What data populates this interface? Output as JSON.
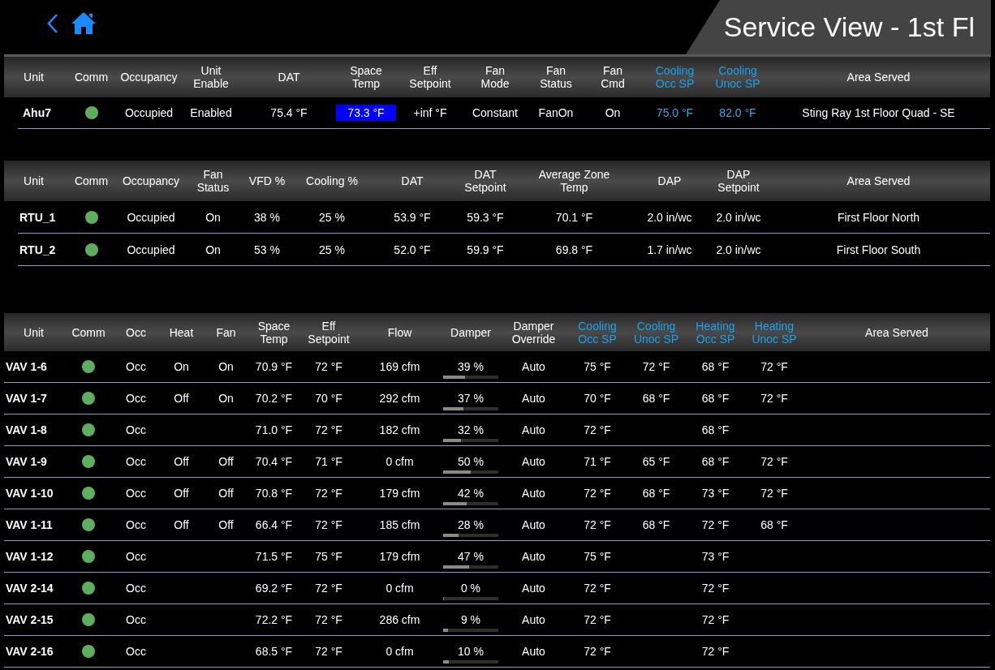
{
  "header": {
    "title": "Service View - 1st Fl"
  },
  "tables": [
    {
      "columns": [
        {
          "label": "Unit",
          "accent": false
        },
        {
          "label": "Comm",
          "accent": false
        },
        {
          "label": "Occupancy",
          "accent": false
        },
        {
          "label": "Unit\nEnable",
          "accent": false
        },
        {
          "label": "DAT",
          "accent": false
        },
        {
          "label": "Space\nTemp",
          "accent": false
        },
        {
          "label": "Eff\nSetpoint",
          "accent": false
        },
        {
          "label": "Fan\nMode",
          "accent": false
        },
        {
          "label": "Fan\nStatus",
          "accent": false
        },
        {
          "label": "Fan\nCmd",
          "accent": false
        },
        {
          "label": "Cooling\nOcc SP",
          "accent": true
        },
        {
          "label": "Cooling\nUnoc SP",
          "accent": true
        },
        {
          "label": "Area Served",
          "accent": false
        }
      ],
      "rows": [
        {
          "cells": [
            "Ahu7",
            {
              "comm": true
            },
            "Occupied",
            "Enabled",
            "75.4 °F",
            {
              "text": "73.3 °F",
              "highlighted": true
            },
            "+inf °F",
            "Constant",
            "FanOn",
            "On",
            {
              "text": "75.0 °F",
              "accent": true
            },
            {
              "text": "82.0 °F",
              "accent": true
            },
            "Sting Ray 1st Floor Quad - SE"
          ]
        }
      ]
    },
    {
      "columns": [
        {
          "label": "Unit",
          "accent": false
        },
        {
          "label": "Comm",
          "accent": false
        },
        {
          "label": "Occupancy",
          "accent": false
        },
        {
          "label": "Fan\nStatus",
          "accent": false
        },
        {
          "label": "VFD %",
          "accent": false
        },
        {
          "label": "Cooling %",
          "accent": false
        },
        {
          "label": "DAT",
          "accent": false
        },
        {
          "label": "DAT\nSetpoint",
          "accent": false
        },
        {
          "label": "Average Zone\nTemp",
          "accent": false
        },
        {
          "label": "DAP",
          "accent": false
        },
        {
          "label": "DAP\nSetpoint",
          "accent": false
        },
        {
          "label": "Area Served",
          "accent": false
        }
      ],
      "rows": [
        {
          "cells": [
            "RTU_1",
            {
              "comm": true
            },
            "Occupied",
            "On",
            "38 %",
            "25 %",
            "53.9 °F",
            "59.3 °F",
            "70.1 °F",
            "2.0 in/wc",
            "2.0 in/wc",
            "First Floor North"
          ]
        },
        {
          "cells": [
            "RTU_2",
            {
              "comm": true
            },
            "Occupied",
            "On",
            "53 %",
            "25 %",
            "52.0 °F",
            "59.9 °F",
            "69.8 °F",
            "1.7 in/wc",
            "2.0 in/wc",
            "First Floor South"
          ]
        }
      ]
    },
    {
      "columns": [
        {
          "label": "Unit",
          "accent": false
        },
        {
          "label": "Comm",
          "accent": false
        },
        {
          "label": "Occ",
          "accent": false
        },
        {
          "label": "Heat",
          "accent": false
        },
        {
          "label": "Fan",
          "accent": false
        },
        {
          "label": "Space\nTemp",
          "accent": false
        },
        {
          "label": "Eff\nSetpoint",
          "accent": false
        },
        {
          "label": "Flow",
          "accent": false
        },
        {
          "label": "Damper",
          "accent": false
        },
        {
          "label": "Damper\nOverride",
          "accent": false
        },
        {
          "label": "Cooling\nOcc SP",
          "accent": true
        },
        {
          "label": "Cooling\nUnoc SP",
          "accent": true
        },
        {
          "label": "Heating\nOcc SP",
          "accent": true
        },
        {
          "label": "Heating\nUnoc SP",
          "accent": true
        },
        {
          "label": "Area Served",
          "accent": false
        }
      ],
      "rows": [
        {
          "cells": [
            "VAV 1-6",
            {
              "comm": true
            },
            "Occ",
            "On",
            "On",
            "70.9 °F",
            "72 °F",
            "169 cfm",
            {
              "text": "39 %",
              "level": 0.39
            },
            "Auto",
            "75 °F",
            "72 °F",
            "68 °F",
            "72 °F",
            null
          ]
        },
        {
          "cells": [
            "VAV 1-7",
            {
              "comm": true
            },
            "Occ",
            "Off",
            "On",
            "70.2 °F",
            "70 °F",
            "292 cfm",
            {
              "text": "37 %",
              "level": 0.37
            },
            "Auto",
            "70 °F",
            "68 °F",
            "68 °F",
            "72 °F",
            null
          ]
        },
        {
          "cells": [
            "VAV 1-8",
            {
              "comm": true
            },
            "Occ",
            null,
            null,
            "71.0 °F",
            "72 °F",
            "182 cfm",
            {
              "text": "32 %",
              "level": 0.32
            },
            "Auto",
            "72 °F",
            null,
            "68 °F",
            null,
            null
          ]
        },
        {
          "cells": [
            "VAV 1-9",
            {
              "comm": true
            },
            "Occ",
            "Off",
            "Off",
            "70.4 °F",
            "71 °F",
            "0 cfm",
            {
              "text": "50 %",
              "level": 0.5
            },
            "Auto",
            "71 °F",
            "65 °F",
            "68 °F",
            "72 °F",
            null
          ]
        },
        {
          "cells": [
            "VAV 1-10",
            {
              "comm": true
            },
            "Occ",
            "Off",
            "Off",
            "70.8 °F",
            "72 °F",
            "179 cfm",
            {
              "text": "42 %",
              "level": 0.42
            },
            "Auto",
            "72 °F",
            "68 °F",
            "73 °F",
            "72 °F",
            null
          ]
        },
        {
          "cells": [
            "VAV 1-11",
            {
              "comm": true
            },
            "Occ",
            "Off",
            "Off",
            "66.4 °F",
            "72 °F",
            "185 cfm",
            {
              "text": "28 %",
              "level": 0.28
            },
            "Auto",
            "72 °F",
            "68 °F",
            "72 °F",
            "68 °F",
            null
          ]
        },
        {
          "cells": [
            "VAV 1-12",
            {
              "comm": true
            },
            "Occ",
            null,
            null,
            "71.5 °F",
            "75 °F",
            "179 cfm",
            {
              "text": "47 %",
              "level": 0.47
            },
            "Auto",
            "75 °F",
            null,
            "73 °F",
            null,
            null
          ]
        },
        {
          "cells": [
            "VAV 2-14",
            {
              "comm": true
            },
            "Occ",
            null,
            null,
            "69.2 °F",
            "72 °F",
            "0 cfm",
            {
              "text": "0 %",
              "level": 0
            },
            "Auto",
            "72 °F",
            null,
            "72 °F",
            null,
            null
          ]
        },
        {
          "cells": [
            "VAV 2-15",
            {
              "comm": true
            },
            "Occ",
            null,
            null,
            "72.2 °F",
            "72 °F",
            "286 cfm",
            {
              "text": "9 %",
              "level": 0.09
            },
            "Auto",
            "72 °F",
            null,
            "72 °F",
            null,
            null
          ]
        },
        {
          "cells": [
            "VAV 2-16",
            {
              "comm": true
            },
            "Occ",
            null,
            null,
            "68.5 °F",
            "72 °F",
            "0 cfm",
            {
              "text": "10 %",
              "level": 0.1
            },
            "Auto",
            "72 °F",
            null,
            "72 °F",
            null,
            null
          ]
        }
      ]
    }
  ]
}
